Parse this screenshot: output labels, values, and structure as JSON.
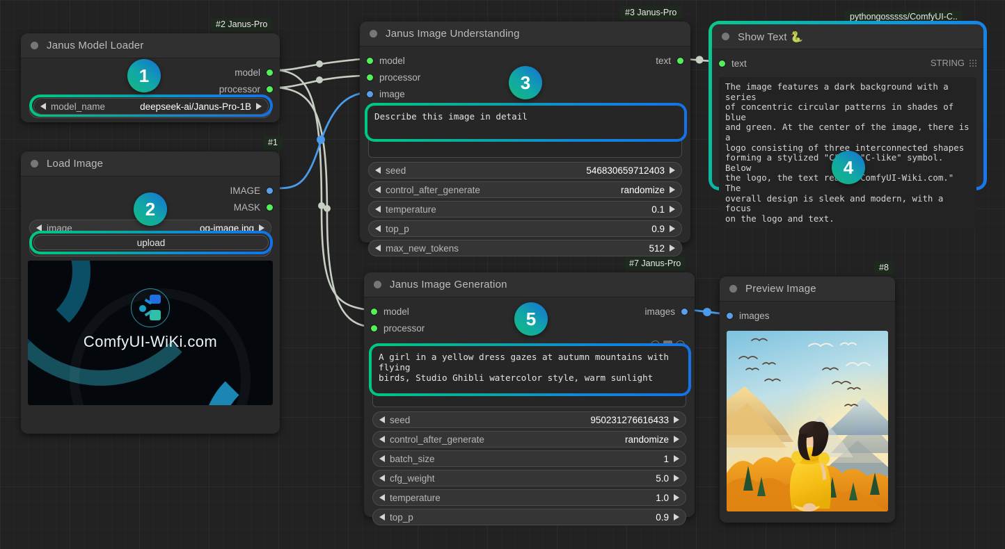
{
  "app": "ComfyUI workflow canvas",
  "badges": {
    "n2": "#2 Janus-Pro",
    "n1": "#1",
    "n3": "#3 Janus-Pro",
    "n4": "pythongosssss/ComfyUI-C..",
    "n7": "#7 Janus-Pro",
    "n8": "#8"
  },
  "colors": {
    "accent_green": "#00c97f",
    "accent_blue": "#1372e8",
    "slot_green": "#54f05a",
    "slot_blue": "#5a9fe8",
    "link_gray": "#c7cfc2",
    "canvas_bg": "#222222",
    "node_bg": "#2a2a2a"
  },
  "steps": {
    "s1": "1",
    "s2": "2",
    "s3": "3",
    "s4": "4",
    "s5": "5"
  },
  "nodes": {
    "model_loader": {
      "title": "Janus Model Loader",
      "outputs": [
        {
          "label": "model",
          "type": "green"
        },
        {
          "label": "processor",
          "type": "green"
        }
      ],
      "widgets": [
        {
          "name": "model_name",
          "value": "deepseek-ai/Janus-Pro-1B"
        }
      ]
    },
    "load_image": {
      "title": "Load Image",
      "outputs": [
        {
          "label": "IMAGE",
          "type": "blue"
        },
        {
          "label": "MASK",
          "type": "green"
        }
      ],
      "widgets": [
        {
          "name": "image",
          "value": "og-image.jpg"
        }
      ],
      "upload_label": "upload",
      "preview_caption": "ComfyUI-WiKi.com"
    },
    "image_understanding": {
      "title": "Janus Image Understanding",
      "inputs": [
        {
          "label": "model",
          "type": "green"
        },
        {
          "label": "processor",
          "type": "green"
        },
        {
          "label": "image",
          "type": "blue"
        }
      ],
      "outputs": [
        {
          "label": "text",
          "type": "green"
        }
      ],
      "prompt": "Describe this image in detail",
      "widgets": [
        {
          "name": "seed",
          "value": "546830659712403"
        },
        {
          "name": "control_after_generate",
          "value": "randomize"
        },
        {
          "name": "temperature",
          "value": "0.1"
        },
        {
          "name": "top_p",
          "value": "0.9"
        },
        {
          "name": "max_new_tokens",
          "value": "512"
        }
      ]
    },
    "show_text": {
      "title": "Show Text 🐍",
      "inputs": [
        {
          "label": "text",
          "type": "green"
        }
      ],
      "type_label": "STRING",
      "output_text": "The image features a dark background with a series\nof concentric circular patterns in shades of blue\nand green. At the center of the image, there is a\nlogo consisting of three interconnected shapes\nforming a stylized \"C\" or \"C-like\" symbol. Below\nthe logo, the text reads \"ComfyUI-Wiki.com.\" The\noverall design is sleek and modern, with a focus\non the logo and text."
    },
    "image_generation": {
      "title": "Janus Image Generation",
      "inputs": [
        {
          "label": "model",
          "type": "green"
        },
        {
          "label": "processor",
          "type": "green"
        }
      ],
      "outputs": [
        {
          "label": "images",
          "type": "blue"
        }
      ],
      "prompt": "A girl in a yellow dress gazes at autumn mountains with flying\nbirds, Studio Ghibli watercolor style, warm sunlight",
      "widgets": [
        {
          "name": "seed",
          "value": "950231276616433"
        },
        {
          "name": "control_after_generate",
          "value": "randomize"
        },
        {
          "name": "batch_size",
          "value": "1"
        },
        {
          "name": "cfg_weight",
          "value": "5.0"
        },
        {
          "name": "temperature",
          "value": "1.0"
        },
        {
          "name": "top_p",
          "value": "0.9"
        }
      ]
    },
    "preview_image": {
      "title": "Preview Image",
      "inputs": [
        {
          "label": "images",
          "type": "blue"
        }
      ]
    }
  }
}
